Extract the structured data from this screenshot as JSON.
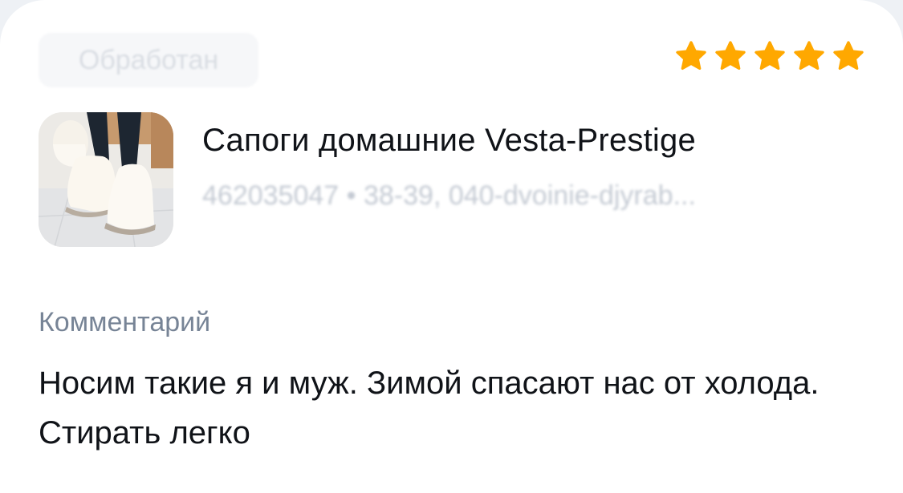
{
  "review": {
    "status": "Обработан",
    "rating": 5,
    "rating_max": 5,
    "star_color": "#ffa800",
    "product": {
      "name": "Сапоги домашние Vesta-Prestige",
      "meta": "462035047 • 38-39, 040-dvoinie-djyrab...",
      "image_icon": "product-photo-slippers"
    },
    "comment": {
      "label": "Комментарий",
      "text": "Носим такие я и муж. Зимой спасают нас от холода. Стирать легко"
    }
  }
}
